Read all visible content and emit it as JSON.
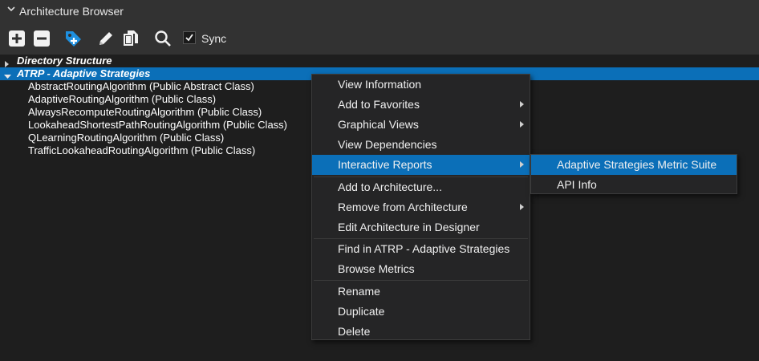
{
  "panel": {
    "title": "Architecture Browser"
  },
  "toolbar": {
    "buttons": [
      "add-icon",
      "remove-icon",
      "tag-add-icon",
      "edit-pencil-icon",
      "copy-icon",
      "search-icon"
    ],
    "sync_label": "Sync",
    "sync_checked": true
  },
  "tree": {
    "nodes": [
      {
        "label": "Directory Structure",
        "expanded": false,
        "selected": false
      },
      {
        "label": "ATRP - Adaptive Strategies",
        "expanded": true,
        "selected": true
      }
    ],
    "children": [
      "AbstractRoutingAlgorithm (Public Abstract Class)",
      "AdaptiveRoutingAlgorithm (Public Class)",
      "AlwaysRecomputeRoutingAlgorithm (Public Class)",
      "LookaheadShortestPathRoutingAlgorithm (Public Class)",
      "QLearningRoutingAlgorithm (Public Class)",
      "TrafficLookaheadRoutingAlgorithm (Public Class)"
    ]
  },
  "context_menu": {
    "items": [
      {
        "label": "View Information",
        "submenu": false
      },
      {
        "label": "Add to Favorites",
        "submenu": true
      },
      {
        "label": "Graphical Views",
        "submenu": true
      },
      {
        "label": "View Dependencies",
        "submenu": false
      },
      {
        "label": "Interactive Reports",
        "submenu": true,
        "highlighted": true
      },
      {
        "label": "Add to Architecture...",
        "submenu": false
      },
      {
        "label": "Remove from Architecture",
        "submenu": true
      },
      {
        "label": "Edit Architecture in Designer",
        "submenu": false
      },
      {
        "label": "Find in ATRP - Adaptive Strategies",
        "submenu": false
      },
      {
        "label": "Browse Metrics",
        "submenu": false
      },
      {
        "label": "Rename",
        "submenu": false
      },
      {
        "label": "Duplicate",
        "submenu": false
      },
      {
        "label": "Delete",
        "submenu": false
      }
    ]
  },
  "submenu": {
    "items": [
      {
        "label": "Adaptive Strategies Metric Suite",
        "highlighted": true
      },
      {
        "label": "API Info",
        "highlighted": false
      }
    ]
  },
  "colors": {
    "selection": "#0b6fb8",
    "background": "#1e1e1e",
    "toolbar": "#323232",
    "accent_icon": "#1e90e0"
  }
}
